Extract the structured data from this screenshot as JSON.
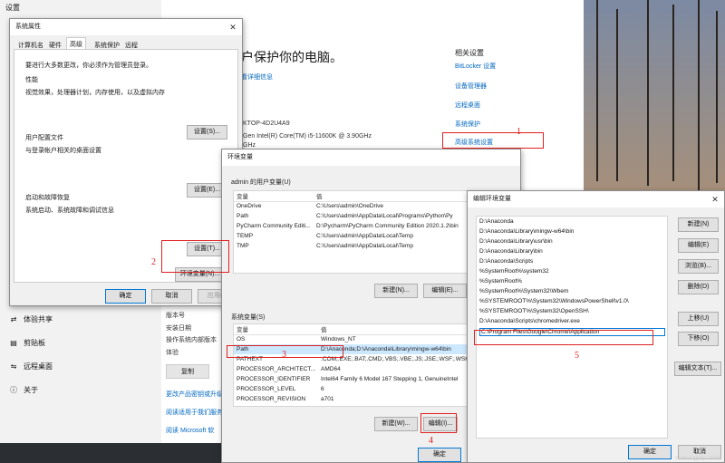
{
  "settings": {
    "app_title": "设置",
    "page_heading": "户保护你的电脑。",
    "view_details_link": "看详细信息",
    "device_name": "KTOP-4D2U4A9",
    "processor": "Gen Intel(R) Core(TM) i5-11600K @ 3.90GHz",
    "ghz": "GHz",
    "related_title": "相关设置",
    "related_links": [
      "BitLocker 设置",
      "设备管理器",
      "远程桌面",
      "系统保护",
      "高级系统设置"
    ],
    "sidebar": [
      "体验共享",
      "剪贴板",
      "远程桌面",
      "关于"
    ],
    "spec_labels": [
      "版本号",
      "安装日期",
      "操作系统内部版本",
      "体验"
    ],
    "copy_button": "复制",
    "bottom_links": [
      "更改产品密钥或升级",
      "阅读适用于我们服务",
      "阅读 Microsoft 软"
    ]
  },
  "sysprops": {
    "title": "系统属性",
    "tabs": [
      "计算机名",
      "硬件",
      "高级",
      "系统保护",
      "远程"
    ],
    "admin_note": "要进行大多数更改，你必须作为管理员登录。",
    "perf_title": "性能",
    "perf_desc": "视觉效果，处理器计划，内存使用，以及虚拟内存",
    "profile_title": "用户配置文件",
    "profile_desc": "与登录帐户相关的桌面设置",
    "startup_title": "启动和故障恢复",
    "startup_desc": "系统启动、系统故障和调试信息",
    "settings_button": "设置(S)...",
    "settings_button_e": "设置(E)...",
    "settings_button_t": "设置(T)...",
    "env_button": "环境变量(N)...",
    "ok": "确定",
    "cancel": "取消",
    "apply": "应用(A)"
  },
  "envvars": {
    "title": "环境变量",
    "user_group": "admin 的用户变量(U)",
    "col_var": "变量",
    "col_val": "值",
    "user_rows": [
      {
        "name": "OneDrive",
        "value": "C:\\Users\\admin\\OneDrive"
      },
      {
        "name": "Path",
        "value": "C:\\Users\\admin\\AppData\\Local\\Programs\\Python\\Py"
      },
      {
        "name": "PyCharm Community Editi...",
        "value": "D:\\Pycharm\\PyCharm Community Edition 2020.1.2\\bin"
      },
      {
        "name": "TEMP",
        "value": "C:\\Users\\admin\\AppData\\Local\\Temp"
      },
      {
        "name": "TMP",
        "value": "C:\\Users\\admin\\AppData\\Local\\Temp"
      }
    ],
    "new_button": "新建(N)...",
    "edit_button": "编辑(E)...",
    "system_group": "系统变量(S)",
    "system_rows": [
      {
        "name": "OS",
        "value": "Windows_NT"
      },
      {
        "name": "Path",
        "value": "D:\\Anaconda;D:\\Anaconda\\Library\\mingw-w64\\bin"
      },
      {
        "name": "PATHEXT",
        "value": ".COM;.EXE;.BAT;.CMD;.VBS;.VBE;.JS;.JSE;.WSF;.WSH;.M"
      },
      {
        "name": "PROCESSOR_ARCHITECT...",
        "value": "AMD64"
      },
      {
        "name": "PROCESSOR_IDENTIFIER",
        "value": "Intel64 Family 6 Model 167 Stepping 1, GenuineIntel"
      },
      {
        "name": "PROCESSOR_LEVEL",
        "value": "6"
      },
      {
        "name": "PROCESSOR_REVISION",
        "value": "a701"
      }
    ],
    "sys_new_button": "新建(W)...",
    "sys_edit_button": "编辑(I)...",
    "ok": "确定"
  },
  "editenv": {
    "title": "编辑环境变量",
    "entries": [
      "D:\\Anaconda",
      "D:\\Anaconda\\Library\\mingw-w64\\bin",
      "D:\\Anaconda\\Library\\usr\\bin",
      "D:\\Anaconda\\Library\\bin",
      "D:\\Anaconda\\Scripts",
      "%SystemRoot%\\system32",
      "%SystemRoot%",
      "%SystemRoot%\\System32\\Wbem",
      "%SYSTEMROOT%\\System32\\WindowsPowerShell\\v1.0\\",
      "%SYSTEMROOT%\\System32\\OpenSSH\\",
      "D:\\Anaconda\\Scripts\\chromedriver.exe",
      "C:\\Program Files\\Google\\Chrome\\Application"
    ],
    "buttons": [
      "新建(N)",
      "编辑(E)",
      "浏览(B)...",
      "删除(D)",
      "上移(U)",
      "下移(O)",
      "编辑文本(T)..."
    ],
    "ok": "确定",
    "cancel": "取消"
  },
  "annotations": [
    "1",
    "2",
    "3",
    "4",
    "5"
  ],
  "watermark": "www.xuyphp.cnlink"
}
